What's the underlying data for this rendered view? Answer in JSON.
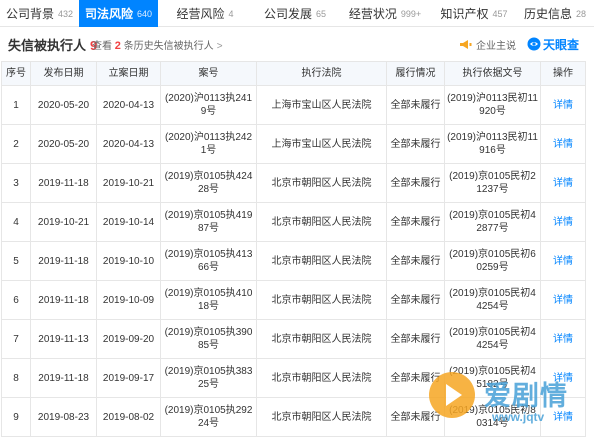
{
  "tabs": [
    {
      "label": "公司背景",
      "count": "432"
    },
    {
      "label": "司法风险",
      "count": "640"
    },
    {
      "label": "经营风险",
      "count": "4"
    },
    {
      "label": "公司发展",
      "count": "65"
    },
    {
      "label": "经营状况",
      "count": "999+"
    },
    {
      "label": "知识产权",
      "count": "457"
    },
    {
      "label": "历史信息",
      "count": "28"
    }
  ],
  "section": {
    "title": "失信被执行人",
    "count": "9",
    "history_prefix": "查看",
    "history_count": "2",
    "history_suffix": "条历史失信被执行人",
    "history_arrow": ">",
    "owner_label": "企业主说",
    "brand": "天眼查"
  },
  "table": {
    "headers": [
      "序号",
      "发布日期",
      "立案日期",
      "案号",
      "执行法院",
      "履行情况",
      "执行依据文号",
      "操作"
    ],
    "rows": [
      {
        "no": "1",
        "publish": "2020-05-20",
        "filed": "2020-04-13",
        "case": "(2020)沪0113执2419号",
        "court": "上海市宝山区人民法院",
        "status": "全部未履行",
        "basis": "(2019)沪0113民初11920号",
        "action": "详情"
      },
      {
        "no": "2",
        "publish": "2020-05-20",
        "filed": "2020-04-13",
        "case": "(2020)沪0113执2421号",
        "court": "上海市宝山区人民法院",
        "status": "全部未履行",
        "basis": "(2019)沪0113民初11916号",
        "action": "详情"
      },
      {
        "no": "3",
        "publish": "2019-11-18",
        "filed": "2019-10-21",
        "case": "(2019)京0105执42428号",
        "court": "北京市朝阳区人民法院",
        "status": "全部未履行",
        "basis": "(2019)京0105民初21237号",
        "action": "详情"
      },
      {
        "no": "4",
        "publish": "2019-10-21",
        "filed": "2019-10-14",
        "case": "(2019)京0105执41987号",
        "court": "北京市朝阳区人民法院",
        "status": "全部未履行",
        "basis": "(2019)京0105民初42877号",
        "action": "详情"
      },
      {
        "no": "5",
        "publish": "2019-11-18",
        "filed": "2019-10-10",
        "case": "(2019)京0105执41366号",
        "court": "北京市朝阳区人民法院",
        "status": "全部未履行",
        "basis": "(2019)京0105民初60259号",
        "action": "详情"
      },
      {
        "no": "6",
        "publish": "2019-11-18",
        "filed": "2019-10-09",
        "case": "(2019)京0105执41018号",
        "court": "北京市朝阳区人民法院",
        "status": "全部未履行",
        "basis": "(2019)京0105民初44254号",
        "action": "详情"
      },
      {
        "no": "7",
        "publish": "2019-11-13",
        "filed": "2019-09-20",
        "case": "(2019)京0105执39085号",
        "court": "北京市朝阳区人民法院",
        "status": "全部未履行",
        "basis": "(2019)京0105民初44254号",
        "action": "详情"
      },
      {
        "no": "8",
        "publish": "2019-11-18",
        "filed": "2019-09-17",
        "case": "(2019)京0105执38325号",
        "court": "北京市朝阳区人民法院",
        "status": "全部未履行",
        "basis": "(2019)京0105民初45182号",
        "action": "详情"
      },
      {
        "no": "9",
        "publish": "2019-08-23",
        "filed": "2019-08-02",
        "case": "(2019)京0105执29224号",
        "court": "北京市朝阳区人民法院",
        "status": "全部未履行",
        "basis": "(2019)京0105民初80314号",
        "action": "详情"
      }
    ]
  },
  "watermark": {
    "text": "爱剧情",
    "url": "www.jqtv"
  },
  "colors": {
    "accent": "#0084ff",
    "alert": "#f04142",
    "header_bg": "#f5f8fc",
    "border": "#e6e6e6"
  }
}
